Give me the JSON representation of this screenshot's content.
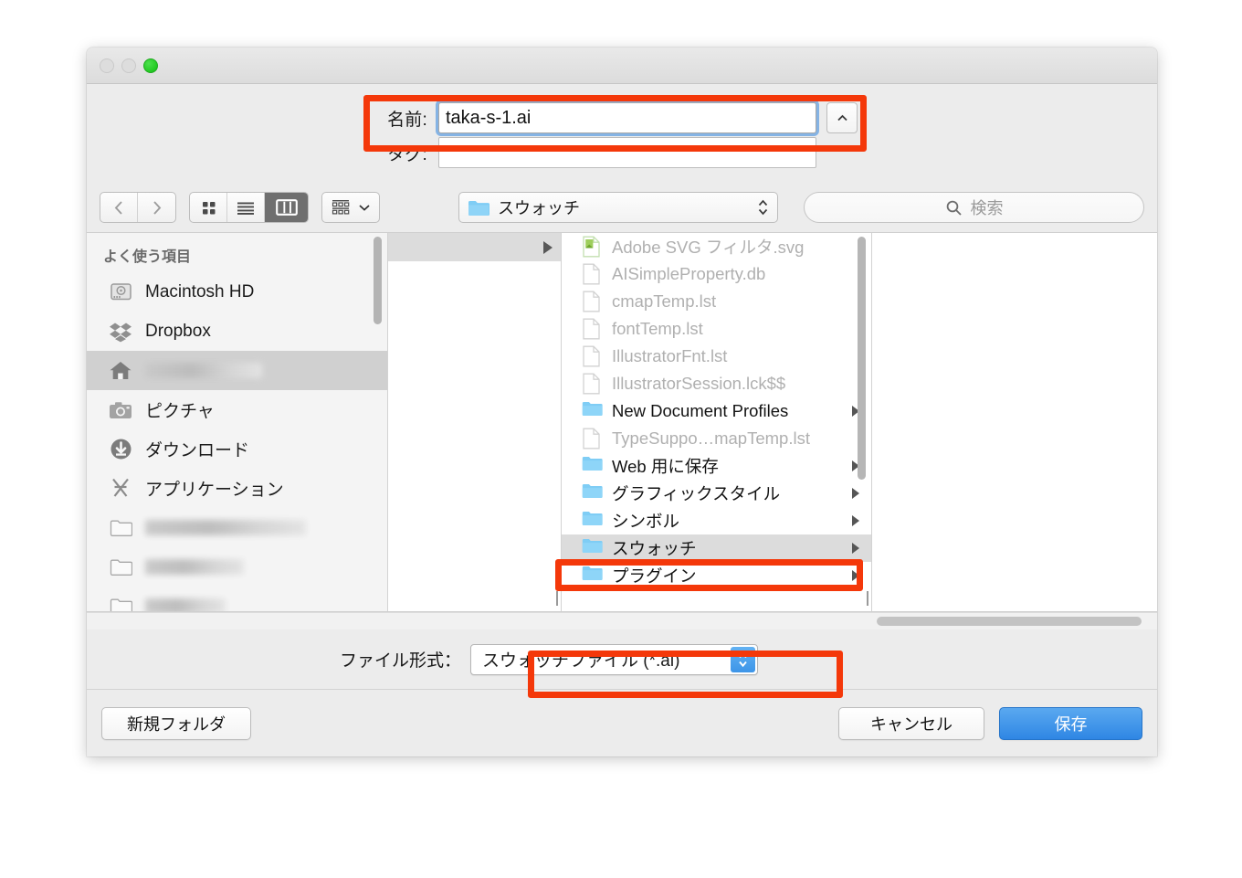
{
  "window": {
    "traffic_lights": [
      "close-disabled",
      "minimize-disabled",
      "zoom-green"
    ]
  },
  "fields": {
    "name_label": "名前:",
    "name_value": "taka-s-1.ai",
    "tag_label": "タグ:",
    "tag_value": "",
    "disclosure_icon": "chevron-up-icon"
  },
  "toolbar": {
    "back_icon": "chevron-left-icon",
    "forward_icon": "chevron-right-icon",
    "view_modes": [
      {
        "name": "icon-view",
        "icon": "grid-icon",
        "active": false
      },
      {
        "name": "list-view",
        "icon": "list-icon",
        "active": false
      },
      {
        "name": "column-view",
        "icon": "columns-icon",
        "active": true
      }
    ],
    "arrange_icon": "arrange-icon",
    "arrange_chevron": "chevron-down-icon",
    "path_folder_icon": "folder-icon",
    "path_label": "スウォッチ",
    "path_stepper_icon": "updown-chevron-icon",
    "search_icon": "search-icon",
    "search_placeholder": "検索"
  },
  "sidebar": {
    "header": "よく使う項目",
    "items": [
      {
        "label": "Macintosh HD",
        "icon": "harddisk-icon",
        "redacted": false,
        "selected": false
      },
      {
        "label": "Dropbox",
        "icon": "dropbox-icon",
        "redacted": false,
        "selected": false
      },
      {
        "label": "",
        "icon": "home-icon",
        "redacted": true,
        "selected": true
      },
      {
        "label": "ピクチャ",
        "icon": "camera-icon",
        "redacted": false,
        "selected": false
      },
      {
        "label": "ダウンロード",
        "icon": "download-icon",
        "redacted": false,
        "selected": false
      },
      {
        "label": "アプリケーション",
        "icon": "applications-icon",
        "redacted": false,
        "selected": false
      },
      {
        "label": "",
        "icon": "folder-icon",
        "redacted": true,
        "selected": false
      },
      {
        "label": "",
        "icon": "folder-icon",
        "redacted": true,
        "selected": false
      },
      {
        "label": "",
        "icon": "folder-icon",
        "redacted": true,
        "selected": false
      }
    ]
  },
  "file_list": [
    {
      "name": "Adobe SVG フィルタ.svg",
      "kind": "svg",
      "dim": true,
      "selected": false,
      "has_arrow": false
    },
    {
      "name": "AISimpleProperty.db",
      "kind": "file",
      "dim": true,
      "selected": false,
      "has_arrow": false
    },
    {
      "name": "cmapTemp.lst",
      "kind": "file",
      "dim": true,
      "selected": false,
      "has_arrow": false
    },
    {
      "name": "fontTemp.lst",
      "kind": "file",
      "dim": true,
      "selected": false,
      "has_arrow": false
    },
    {
      "name": "IllustratorFnt.lst",
      "kind": "file",
      "dim": true,
      "selected": false,
      "has_arrow": false
    },
    {
      "name": "IllustratorSession.lck$$",
      "kind": "file",
      "dim": true,
      "selected": false,
      "has_arrow": false
    },
    {
      "name": "New Document Profiles",
      "kind": "folder",
      "dim": false,
      "selected": false,
      "has_arrow": true
    },
    {
      "name": "TypeSuppo…mapTemp.lst",
      "kind": "file",
      "dim": true,
      "selected": false,
      "has_arrow": false
    },
    {
      "name": "Web 用に保存",
      "kind": "folder",
      "dim": false,
      "selected": false,
      "has_arrow": true
    },
    {
      "name": "グラフィックスタイル",
      "kind": "folder",
      "dim": false,
      "selected": false,
      "has_arrow": true
    },
    {
      "name": "シンボル",
      "kind": "folder",
      "dim": false,
      "selected": false,
      "has_arrow": true
    },
    {
      "name": "スウォッチ",
      "kind": "folder",
      "dim": false,
      "selected": true,
      "has_arrow": true
    },
    {
      "name": "プラグイン",
      "kind": "folder",
      "dim": false,
      "selected": false,
      "has_arrow": true
    }
  ],
  "format": {
    "label": "ファイル形式：",
    "value": "スウォッチファイル (*.ai)",
    "stepper_icon": "updown-chevron-icon"
  },
  "buttons": {
    "new_folder": "新規フォルダ",
    "cancel": "キャンセル",
    "save": "保存"
  },
  "annotations": {
    "color": "#f4380a",
    "targets": [
      "name-field",
      "swatch-folder-row",
      "file-format-popup"
    ]
  }
}
